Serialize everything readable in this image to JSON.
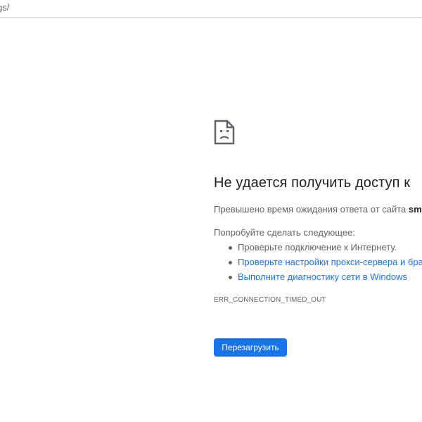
{
  "browser": {
    "address_text": "gs/"
  },
  "error_page": {
    "icon": "sad-document-icon",
    "heading": "Не удается получить доступ к",
    "summary_prefix": "Превышено время ожидания ответа от сайта ",
    "summary_host": "sms",
    "try_label": "Попробуйте сделать следующее:",
    "suggestions": [
      {
        "text": "Проверьте подключение к Интернету.",
        "link": false
      },
      {
        "text": "Проверьте настройки прокси-сервера и бра",
        "link": true
      },
      {
        "text": "Выполните диагностику сети в Windows",
        "link": true
      }
    ],
    "error_code": "ERR_CONNECTION_TIMED_OUT",
    "reload_label": "Перезагрузить"
  },
  "colors": {
    "link": "#1a73e8",
    "button_bg": "#1a73e8",
    "text_primary": "#202124",
    "text_secondary": "#5f6368"
  }
}
